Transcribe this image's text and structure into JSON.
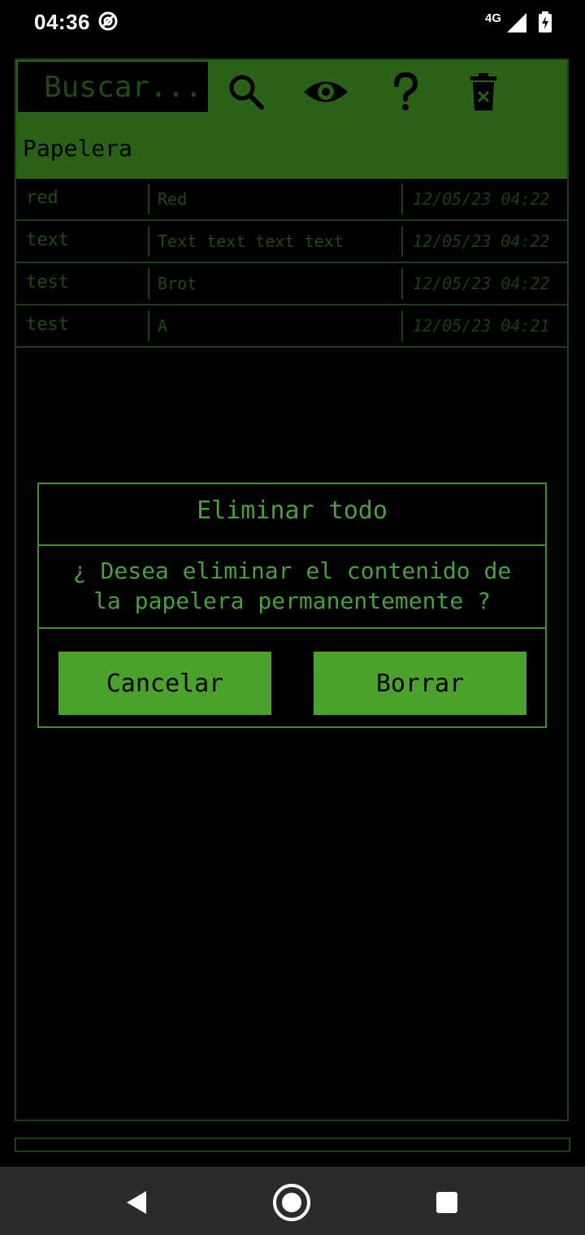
{
  "status": {
    "time": "04:36",
    "network": "4G",
    "icons": [
      "at-sign-icon",
      "signal-icon",
      "battery-charging-icon"
    ]
  },
  "toolbar": {
    "search_placeholder": "Buscar...",
    "icons": [
      "search-icon",
      "eye-icon",
      "help-icon",
      "trash-icon"
    ],
    "color": "#296117"
  },
  "section_title": "Papelera",
  "rows": [
    {
      "name": "red",
      "content": "Red",
      "date": "12/05/23 04:22"
    },
    {
      "name": "text",
      "content": "Text text text text",
      "date": "12/05/23 04:22"
    },
    {
      "name": "test",
      "content": "Brot",
      "date": "12/05/23 04:22"
    },
    {
      "name": "test",
      "content": "A",
      "date": "12/05/23 04:21"
    }
  ],
  "dialog": {
    "title": "Eliminar todo",
    "message_line1": "¿ Desea eliminar el contenido de",
    "message_line2": "la papelera permanentemente ?",
    "cancel_label": "Cancelar",
    "delete_label": "Borrar",
    "button_color": "#4aa12b"
  },
  "navbar": {
    "icons": [
      "back-icon",
      "home-icon",
      "recents-icon"
    ]
  }
}
